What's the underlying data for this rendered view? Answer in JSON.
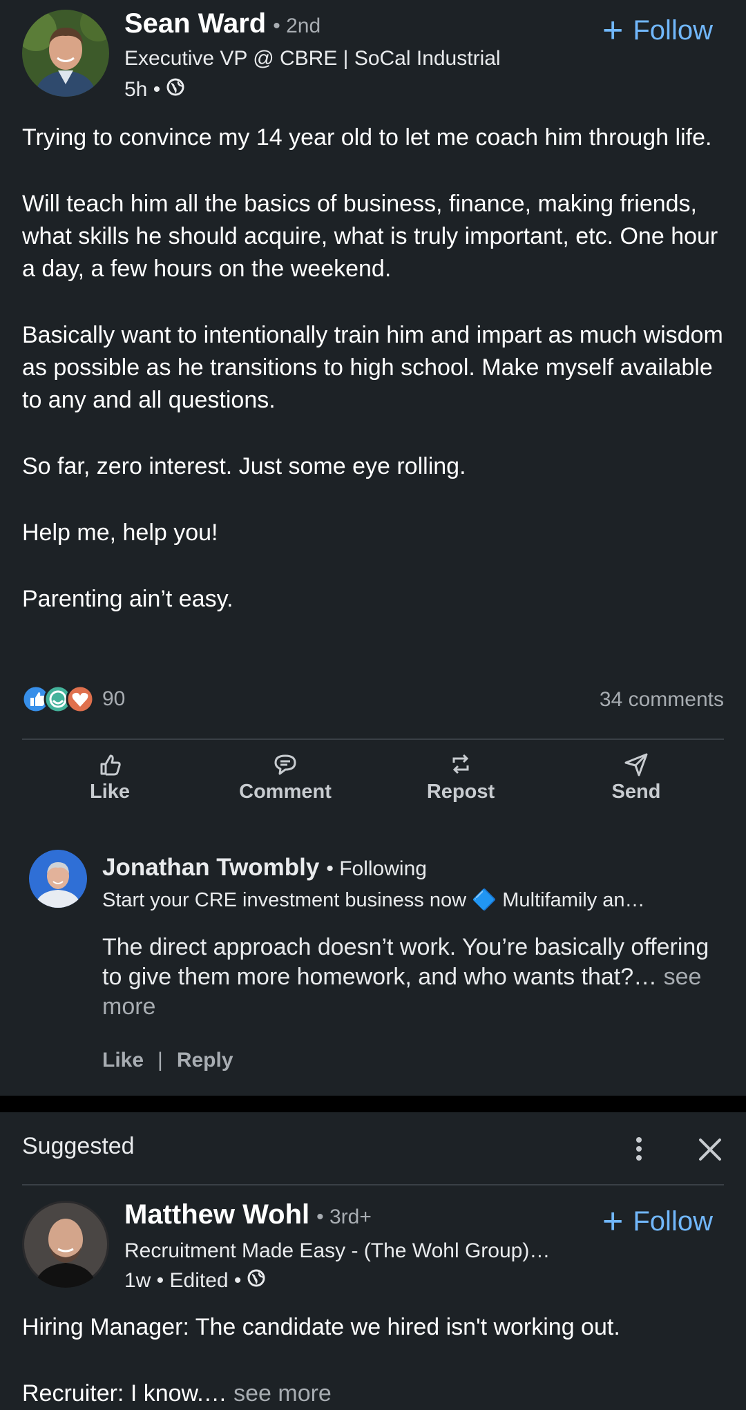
{
  "post1": {
    "author_name": "Sean Ward",
    "degree": "• 2nd",
    "headline": "Executive VP @ CBRE | SoCal Industrial",
    "time": "5h •",
    "follow_label": "Follow",
    "paragraphs": [
      "Trying to convince my 14 year old to let me coach him through life.",
      "Will teach him all the basics of business, finance, making friends, what skills he should acquire, what is truly important, etc. One hour a day, a few hours on the weekend.",
      "Basically want to intentionally train him and impart as much wisdom as possible as he transitions to high school. Make myself available to any and all questions.",
      "So far, zero interest. Just some eye rolling.",
      "Help me, help you!",
      "Parenting ain’t easy."
    ],
    "reactions_count": "90",
    "comments_count": "34 comments",
    "actions": {
      "like": "Like",
      "comment": "Comment",
      "repost": "Repost",
      "send": "Send"
    }
  },
  "comment": {
    "author_name": "Jonathan Twombly",
    "relation": "• Following",
    "headline": "Start your CRE investment business now 🔷 Multifamily an…",
    "text": "The direct approach doesn’t work. You’re basically offering to give them more homework, and who wants that?…",
    "see_more": "see more",
    "like": "Like",
    "separator": "|",
    "reply": "Reply"
  },
  "post2": {
    "label": "Suggested",
    "author_name": "Matthew Wohl",
    "degree": "• 3rd+",
    "headline": "Recruitment Made Easy - (The Wohl Group)…",
    "time": "1w • Edited •",
    "follow_label": "Follow",
    "line1": "Hiring Manager: The candidate we hired isn't working out.",
    "line2": "Recruiter: I know.…",
    "see_more": "see more"
  },
  "colors": {
    "background": "#1d2226",
    "accent_blue": "#71b7fb",
    "like_blue": "#378fe9",
    "celebrate_green": "#44b39b",
    "love_red": "#df704d"
  },
  "icons": [
    "globe-icon",
    "plus-icon",
    "like-icon",
    "comment-icon",
    "repost-icon",
    "send-icon",
    "more-vertical-icon",
    "close-icon"
  ]
}
